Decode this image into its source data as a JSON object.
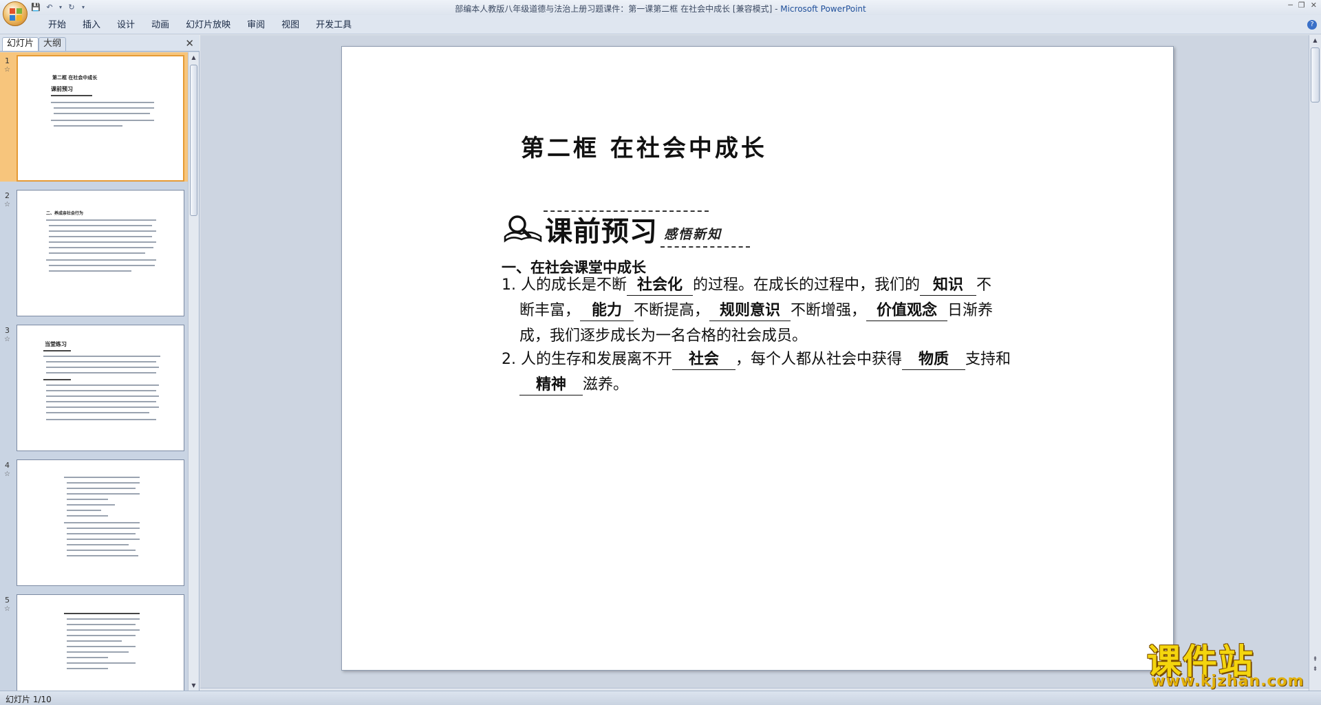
{
  "window": {
    "title_prefix": "部编本人教版八年级道德与法治上册习题课件：第一课第二框 在社会中成长 [兼容模式] - ",
    "title_brand": "Microsoft PowerPoint"
  },
  "ribbon": {
    "tabs": [
      "开始",
      "插入",
      "设计",
      "动画",
      "幻灯片放映",
      "审阅",
      "视图",
      "开发工具"
    ]
  },
  "left_pane": {
    "tab_slides": "幻灯片",
    "tab_outline": "大纲",
    "close": "✕",
    "thumbnails": [
      {
        "num": "1",
        "head": "第二框  在社会中成长",
        "sub": "课前预习"
      },
      {
        "num": "2",
        "head": "二、养成亲社会行为",
        "sub": ""
      },
      {
        "num": "3",
        "head": "当堂练习",
        "sub": ""
      },
      {
        "num": "4",
        "head": "",
        "sub": ""
      },
      {
        "num": "5",
        "head": "",
        "sub": ""
      }
    ]
  },
  "slide": {
    "title": "第二框  在社会中成长",
    "banner_label": "课前预习",
    "banner_sub": "感悟新知",
    "section_heading": "一、在社会课堂中成长",
    "item1": {
      "l1_a": "1. 人的成长是不断",
      "b1": "社会化",
      "l1_b": "的过程。在成长的过程中，我们的",
      "b2": "知识",
      "l1_c": "不",
      "l2_a": "断丰富，",
      "b3": "能力",
      "l2_b": "不断提高，",
      "b4": "规则意识",
      "l2_c": "不断增强，",
      "b5": "价值观念",
      "l2_d": "日渐养",
      "l3": "成，我们逐步成长为一名合格的社会成员。"
    },
    "item2": {
      "l1_a": "2. 人的生存和发展离不开",
      "b1": "社会",
      "l1_b": "，每个人都从社会中获得",
      "b2": "物质",
      "l1_c": "支持和",
      "b3": "精神",
      "l2_b": "滋养。"
    }
  },
  "status": {
    "slide_counter": "幻灯片 1/10"
  },
  "watermark": {
    "big": "课件站",
    "url": "www.kjzhan.com"
  },
  "colors": {
    "accent_brand": "#1f4f9a",
    "selected_thumb": "#f7c57c",
    "watermark_yellow": "#f4d50e"
  }
}
